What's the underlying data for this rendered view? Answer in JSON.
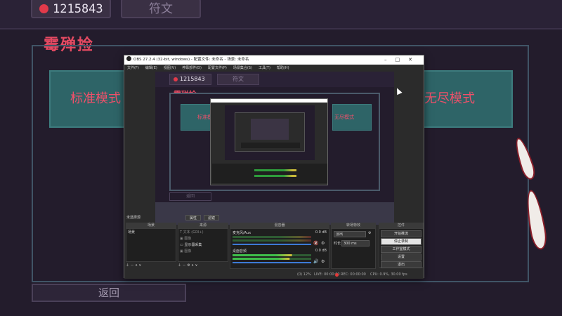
{
  "game": {
    "score": "1215843",
    "tab": "符文",
    "title": "霉殚捡",
    "mode_left": "标准模式",
    "mode_right": "无尽模式",
    "back": "返回"
  },
  "obs": {
    "title": "OBS 27.2.4 (32-bit, windows) - 配置文件: 未命名 - 场景: 未命名",
    "menu": [
      "文件(F)",
      "编辑(E)",
      "视图(V)",
      "停靠部件(D)",
      "配置文件(P)",
      "场景集合(S)",
      "工具(T)",
      "帮助(H)"
    ],
    "no_source": "未选择源",
    "props_btn": "属性",
    "filters_btn": "滤镜",
    "docks": {
      "scenes": "场景",
      "sources": "来源",
      "mixer": "混音器",
      "transitions": "转场特效",
      "controls": "控件"
    },
    "scenes_list": [
      "场景"
    ],
    "sources_list": [
      "文本 (GDI+)",
      "图像",
      "显示器采集",
      "图像"
    ],
    "mixer": [
      {
        "name": "麦克风/Aux",
        "db": "0.0 dB"
      },
      {
        "name": "桌面音频",
        "db": "0.0 dB"
      }
    ],
    "transition": {
      "type": "淡出",
      "duration_label": "时长",
      "duration_value": "300 ms"
    },
    "controls": [
      "开始推流",
      "停止录制",
      "工作室模式",
      "设置",
      "退出"
    ],
    "status": {
      "live": "LIVE: 00:00:00",
      "rec": "REC: 00:00:00",
      "cpu": "CPU: 0.9%, 30.00 fps",
      "dropped": "(0) 12%"
    }
  },
  "colors": {
    "accent_red": "#e54a62",
    "mode_teal": "#2e6467",
    "bg": "#231c2c"
  }
}
